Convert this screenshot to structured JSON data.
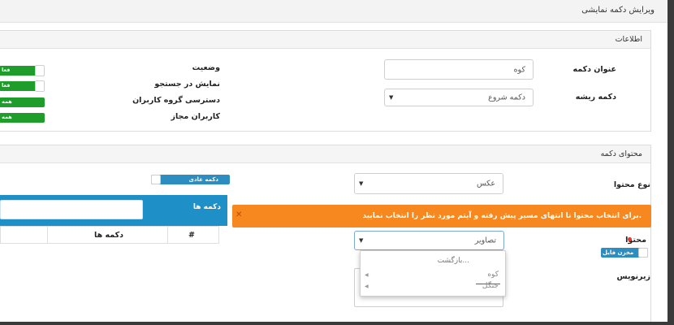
{
  "page": {
    "title": "ویرایش دکمه نمایشی"
  },
  "info_panel": {
    "title": "اطلاعات",
    "button_title_label": "عنوان دکمه",
    "button_title_value": "کوه",
    "root_button_label": "دکمه ریشه",
    "root_button_value": "دکمه شروع",
    "status_label": "وضعیت",
    "show_in_search_label": "نمایش در جستجو",
    "user_group_access_label": "دسترسی گروه کاربران",
    "allowed_users_label": "کاربران مجاز",
    "toggle_status_text": "فعا",
    "toggle_search_text": "فعا",
    "toggle_group_text": "همه",
    "toggle_users_text": "همه"
  },
  "content_panel": {
    "title": "محتوای دکمه",
    "content_type_label": "نوع محتوا",
    "content_type_value": "عکس",
    "normal_button_text": "دکمه عادی",
    "alert_text": "برای انتخاب محتوا تا انتهای مسیر پیش رفته و آیتم مورد نظر را انتخاب نمایید.",
    "content_label": "محتوا",
    "content_value": "تصاویر",
    "file_storage_text": "مخزن فایل",
    "caption_label": "زیرنویس",
    "dropdown": {
      "back": "بازگشت...",
      "items": [
        "کوه",
        "جنگل"
      ]
    },
    "buttons_box": {
      "title": "دکمه ها",
      "col_index": "#",
      "col_buttons": "دکمه ها"
    }
  },
  "colors": {
    "accent_green": "#1f9d2a",
    "alert_orange": "#f7871f",
    "panel_blue": "#1f8fc8"
  }
}
